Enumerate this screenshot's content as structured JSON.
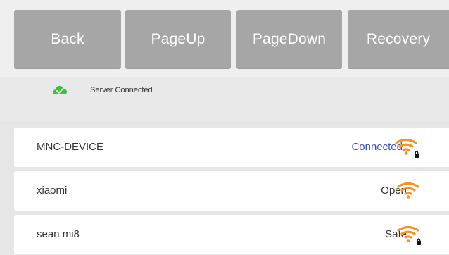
{
  "toolbar": {
    "back_label": "Back",
    "pageup_label": "PageUp",
    "pagedown_label": "PageDown",
    "recovery_label": "Recovery"
  },
  "status": {
    "icon": "cloud-check-icon",
    "text": "Server Connected",
    "icon_color": "#3fbf3f"
  },
  "networks": [
    {
      "name": "MNC-DEVICE",
      "status": "Connected",
      "locked": true,
      "icon": "wifi-icon"
    },
    {
      "name": "xiaomi",
      "status": "Open",
      "locked": false,
      "icon": "wifi-icon"
    },
    {
      "name": "sean mi8",
      "status": "Safe",
      "locked": true,
      "icon": "wifi-icon"
    }
  ],
  "colors": {
    "button_bg": "#a6a6a6",
    "wifi_orange": "#f7922a",
    "connected_blue": "#3b4fb8"
  }
}
